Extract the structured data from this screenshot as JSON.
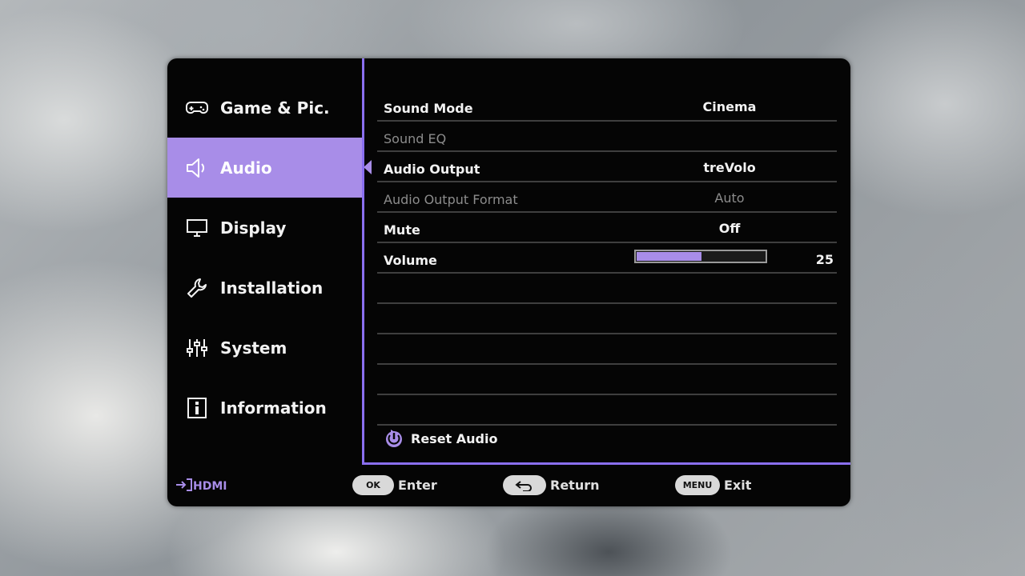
{
  "sidebar": {
    "items": [
      {
        "label": "Game & Pic.",
        "icon": "gamepad-icon"
      },
      {
        "label": "Audio",
        "icon": "speaker-icon",
        "active": true
      },
      {
        "label": "Display",
        "icon": "monitor-icon"
      },
      {
        "label": "Installation",
        "icon": "wrench-icon"
      },
      {
        "label": "System",
        "icon": "sliders-icon"
      },
      {
        "label": "Information",
        "icon": "info-icon"
      }
    ]
  },
  "settings": {
    "sound_mode": {
      "label": "Sound Mode",
      "value": "Cinema"
    },
    "sound_eq": {
      "label": "Sound EQ",
      "value": ""
    },
    "audio_output": {
      "label": "Audio Output",
      "value": "treVolo"
    },
    "audio_output_format": {
      "label": "Audio Output Format",
      "value": "Auto"
    },
    "mute": {
      "label": "Mute",
      "value": "Off"
    },
    "volume": {
      "label": "Volume",
      "value": "25",
      "level": 0.5
    }
  },
  "reset": {
    "label": "Reset Audio"
  },
  "footer": {
    "source": "HDMI",
    "ok": {
      "key": "OK",
      "label": "Enter"
    },
    "back": {
      "label": "Return"
    },
    "menu": {
      "key": "MENU",
      "label": "Exit"
    }
  },
  "colors": {
    "accent": "#a88de8",
    "panel": "#050505"
  }
}
